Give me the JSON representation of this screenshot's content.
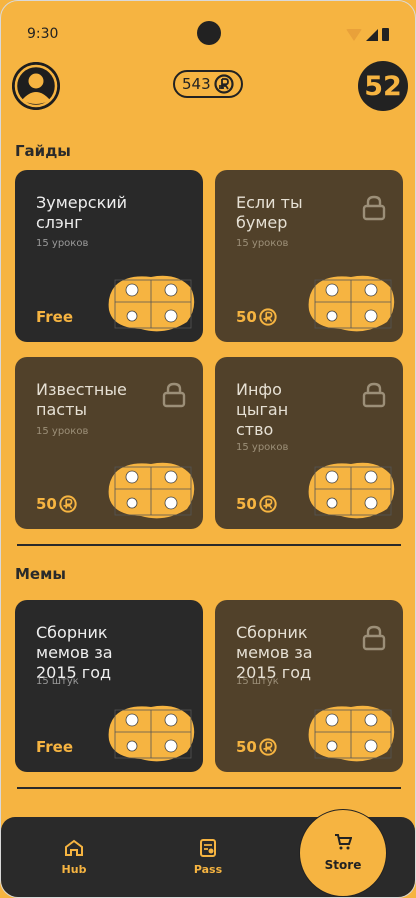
{
  "status": {
    "time": "9:30"
  },
  "header": {
    "coins": "543",
    "level": "52"
  },
  "sections": {
    "guides": "Гайды",
    "memes": "Мемы"
  },
  "cards": [
    {
      "title": "Зумерский слэнг",
      "sub": "15 уроков",
      "price": "Free",
      "locked": false
    },
    {
      "title": "Если ты бумер",
      "sub": "15 уроков",
      "price": "50",
      "locked": true
    },
    {
      "title": "Известные пасты",
      "sub": "15 уроков",
      "price": "50",
      "locked": true
    },
    {
      "title": "Инфо цыган ство",
      "sub": "15 уроков",
      "price": "50",
      "locked": true
    },
    {
      "title": "Сборник мемов за 2015 год",
      "sub": "15 штук",
      "price": "Free",
      "locked": false
    },
    {
      "title": "Сборник мемов за 2015 год",
      "sub": "15 штук",
      "price": "50",
      "locked": true
    }
  ],
  "nav": {
    "hub": "Hub",
    "pass": "Pass",
    "store": "Store"
  },
  "colors": {
    "accent": "#f6b441",
    "dark": "#292929",
    "locked": "#51412a"
  }
}
